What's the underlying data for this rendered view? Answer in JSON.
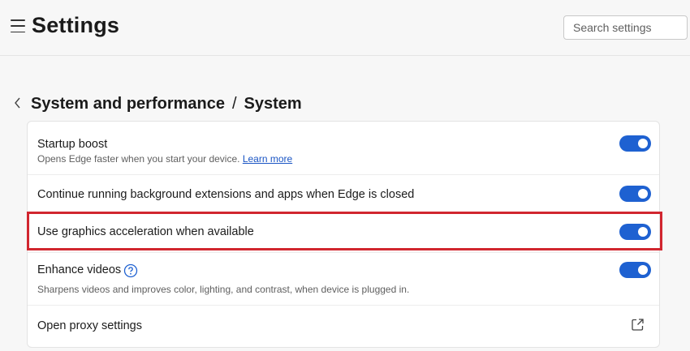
{
  "header": {
    "title": "Settings",
    "search_placeholder": "Search settings"
  },
  "breadcrumb": {
    "parent": "System and performance",
    "separator": "/",
    "current": "System"
  },
  "settings": {
    "startup_boost": {
      "label": "Startup boost",
      "description": "Opens Edge faster when you start your device.",
      "link": "Learn more",
      "enabled": true
    },
    "background_extensions": {
      "label": "Continue running background extensions and apps when Edge is closed",
      "enabled": true
    },
    "graphics_acceleration": {
      "label": "Use graphics acceleration when available",
      "enabled": true
    },
    "enhance_videos": {
      "label": "Enhance videos",
      "description": "Sharpens videos and improves color, lighting, and contrast, when device is plugged in.",
      "enabled": true
    },
    "proxy": {
      "label": "Open proxy settings"
    }
  },
  "colors": {
    "toggle_on": "#1e61d1",
    "highlight": "#d1262f",
    "link": "#1a55c4"
  },
  "icons": [
    "hamburger-menu-icon",
    "chevron-left-icon",
    "help-circle-icon",
    "external-link-icon"
  ]
}
